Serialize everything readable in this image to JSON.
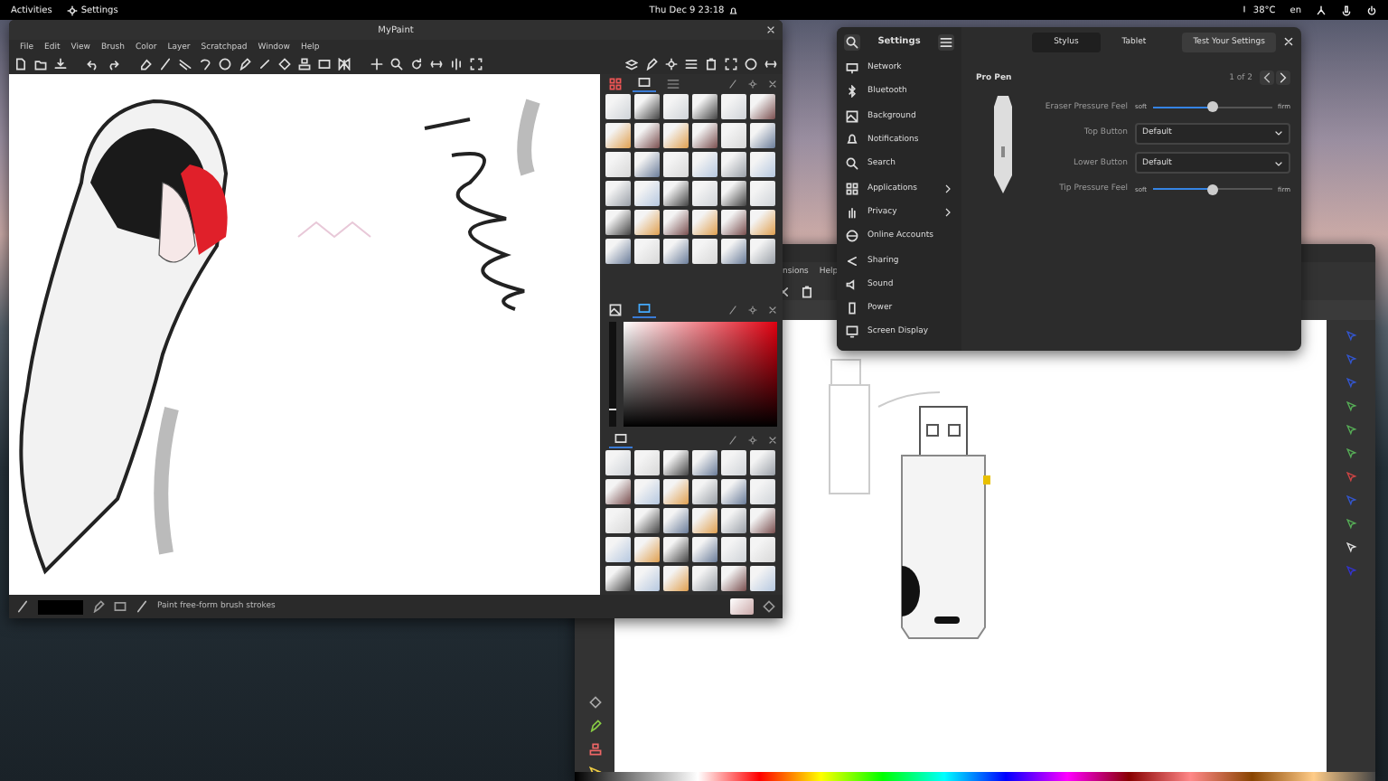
{
  "top_bar": {
    "activities": "Activities",
    "app_menu": "Settings",
    "clock": "Thu Dec 9  23:18",
    "temperature": "38°C",
    "input_source": "en"
  },
  "mypaint": {
    "title": "MyPaint",
    "menu": [
      "File",
      "Edit",
      "View",
      "Brush",
      "Color",
      "Layer",
      "Scratchpad",
      "Window",
      "Help"
    ],
    "status_text": "Paint free-form brush strokes",
    "color_value": {
      "level": 0.15
    }
  },
  "inkscape": {
    "menu": [
      "nsions",
      "Help"
    ]
  },
  "settings": {
    "title": "Settings",
    "sidebar": [
      {
        "label": "Network",
        "submenu": false
      },
      {
        "label": "Bluetooth",
        "submenu": false
      },
      {
        "label": "Background",
        "submenu": false
      },
      {
        "label": "Notifications",
        "submenu": false
      },
      {
        "label": "Search",
        "submenu": false
      },
      {
        "label": "Applications",
        "submenu": true
      },
      {
        "label": "Privacy",
        "submenu": true
      },
      {
        "label": "Online Accounts",
        "submenu": false
      },
      {
        "label": "Sharing",
        "submenu": false
      },
      {
        "label": "Sound",
        "submenu": false
      },
      {
        "label": "Power",
        "submenu": false
      },
      {
        "label": "Screen Display",
        "submenu": false
      }
    ],
    "tabs": [
      {
        "label": "Stylus",
        "selected": true
      },
      {
        "label": "Tablet",
        "selected": false
      }
    ],
    "test_button": "Test Your Settings",
    "device": "Pro Pen",
    "pager": "1 of 2",
    "rows": [
      {
        "kind": "slider",
        "label": "Eraser Pressure Feel",
        "min_label": "soft",
        "max_label": "firm",
        "level": 0.5
      },
      {
        "kind": "dropdown",
        "label": "Top Button",
        "value": "Default"
      },
      {
        "kind": "dropdown",
        "label": "Lower Button",
        "value": "Default"
      },
      {
        "kind": "slider",
        "label": "Tip Pressure Feel",
        "min_label": "soft",
        "max_label": "firm",
        "level": 0.5
      }
    ]
  }
}
